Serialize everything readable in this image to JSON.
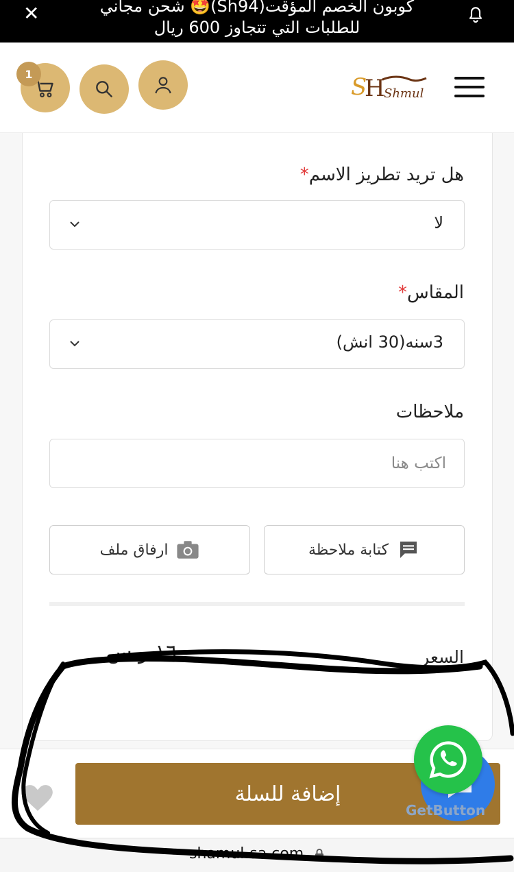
{
  "banner": {
    "line1": "كوبون الخصم المؤقت(Sh94)🤩 شحن مجاني",
    "line2": "للطلبات التي تتجاوز 600 ريال"
  },
  "header": {
    "cart_count": "1",
    "logo_text": "Shmul"
  },
  "form": {
    "embroidery": {
      "label": "هل تريد تطريز الاسم",
      "required_mark": "*",
      "value": "لا"
    },
    "size": {
      "label": "المقاس",
      "required_mark": "*",
      "value": "3سنه(30 انش)"
    },
    "notes": {
      "label": "ملاحظات",
      "placeholder": "اكتب هنا"
    },
    "write_note_label": "كتابة ملاحظة",
    "attach_file_label": "ارفاق ملف"
  },
  "price": {
    "label": "السعر",
    "value": "١٦٠ ر.س"
  },
  "bottom": {
    "add_to_cart_label": "إضافة للسلة",
    "getbutton_label": "GetButton"
  },
  "browser": {
    "url": "shamul-sa.com"
  },
  "colors": {
    "accent": "#dcb873",
    "button": "#a0752f",
    "whatsapp": "#25c24a"
  }
}
